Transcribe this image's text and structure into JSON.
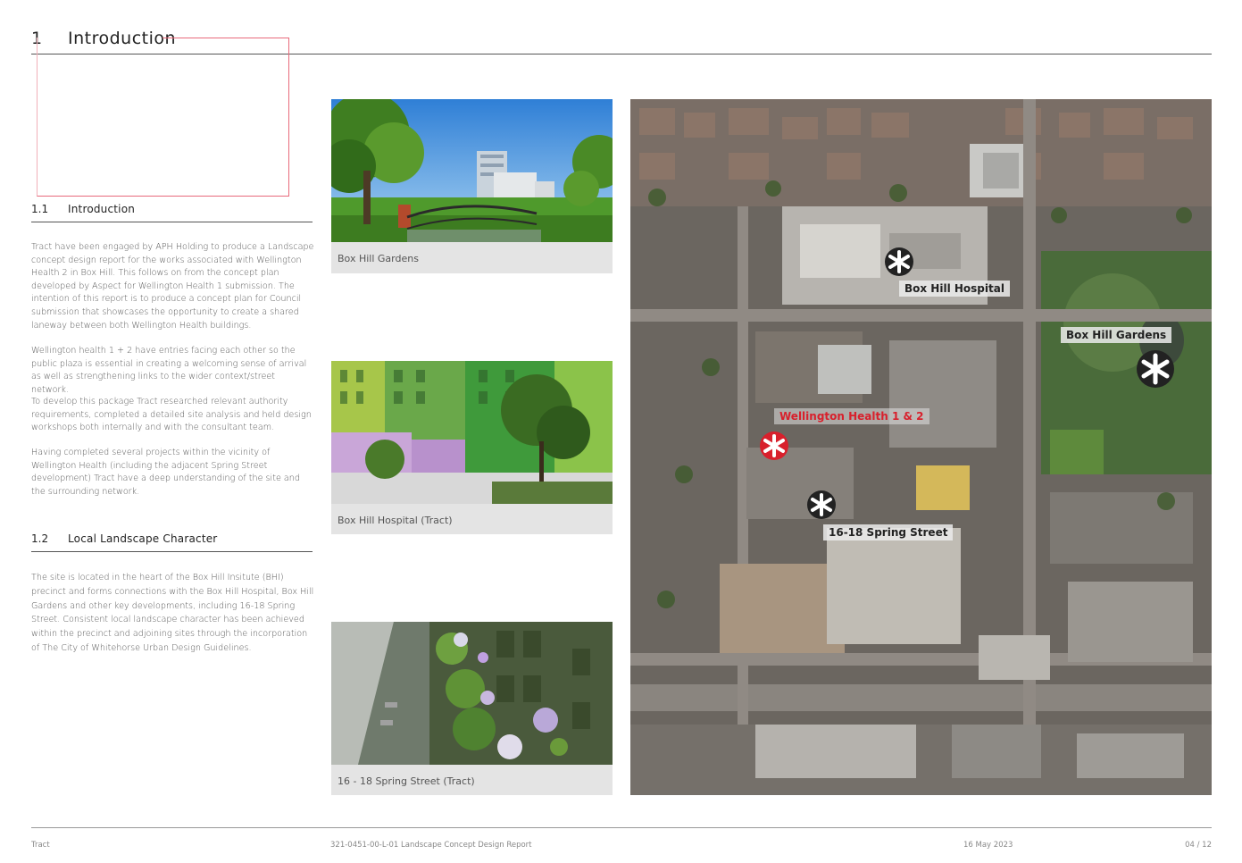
{
  "header": {
    "number": "1",
    "title": "Introduction"
  },
  "section1": {
    "number": "1.1",
    "title": "Introduction",
    "paragraphs": [
      "Tract have been engaged by APH Holding to produce a Landscape concept design report for the works associated with Wellington Health 2 in Box Hill. This follows on from the concept plan developed by Aspect for Wellington Health 1 submission. The intention of this report is to produce a concept plan for Council submission that showcases the opportunity to create a shared laneway between both Wellington Health buildings.",
      "Wellington health 1 + 2 have entries facing each other so the public plaza is essential in creating a welcoming sense of arrival as well as strengthening links to the wider context/street network.",
      "To develop this package Tract researched  relevant authority requirements, completed a detailed site analysis and held design workshops both internally and with the consultant team.",
      "Having completed several projects within the vicinity of Wellington Health (including the adjacent Spring Street development) Tract have a deep understanding of the site and the surrounding network."
    ]
  },
  "section2": {
    "number": "1.2",
    "title": "Local Landscape Character",
    "paragraphs": [
      "The site is located in the heart of the Box Hill Insitute (BHI) precinct and forms connections with the Box Hill Hospital, Box Hill Gardens and other key developments, including 16-18 Spring Street. Consistent local landscape character has been achieved within the precinct and adjoining sites through the incorporation of The City of Whitehorse Urban Design Guidelines."
    ]
  },
  "photos": [
    {
      "caption": "Box Hill Gardens"
    },
    {
      "caption": "Box Hill Hospital (Tract)"
    },
    {
      "caption": "16 - 18 Spring Street (Tract)"
    }
  ],
  "map": {
    "labels": {
      "hospital": "Box Hill Hospital",
      "gardens": "Box Hill Gardens",
      "wellington": "Wellington Health 1 & 2",
      "spring": "16-18 Spring Street"
    },
    "colors": {
      "highlight": "#d8202c",
      "marker": "#ffffff"
    }
  },
  "footer": {
    "company": "Tract",
    "document": "321-0451-00-L-01 Landscape Concept Design Report",
    "date": "16 May 2023",
    "page": "04 / 12"
  }
}
